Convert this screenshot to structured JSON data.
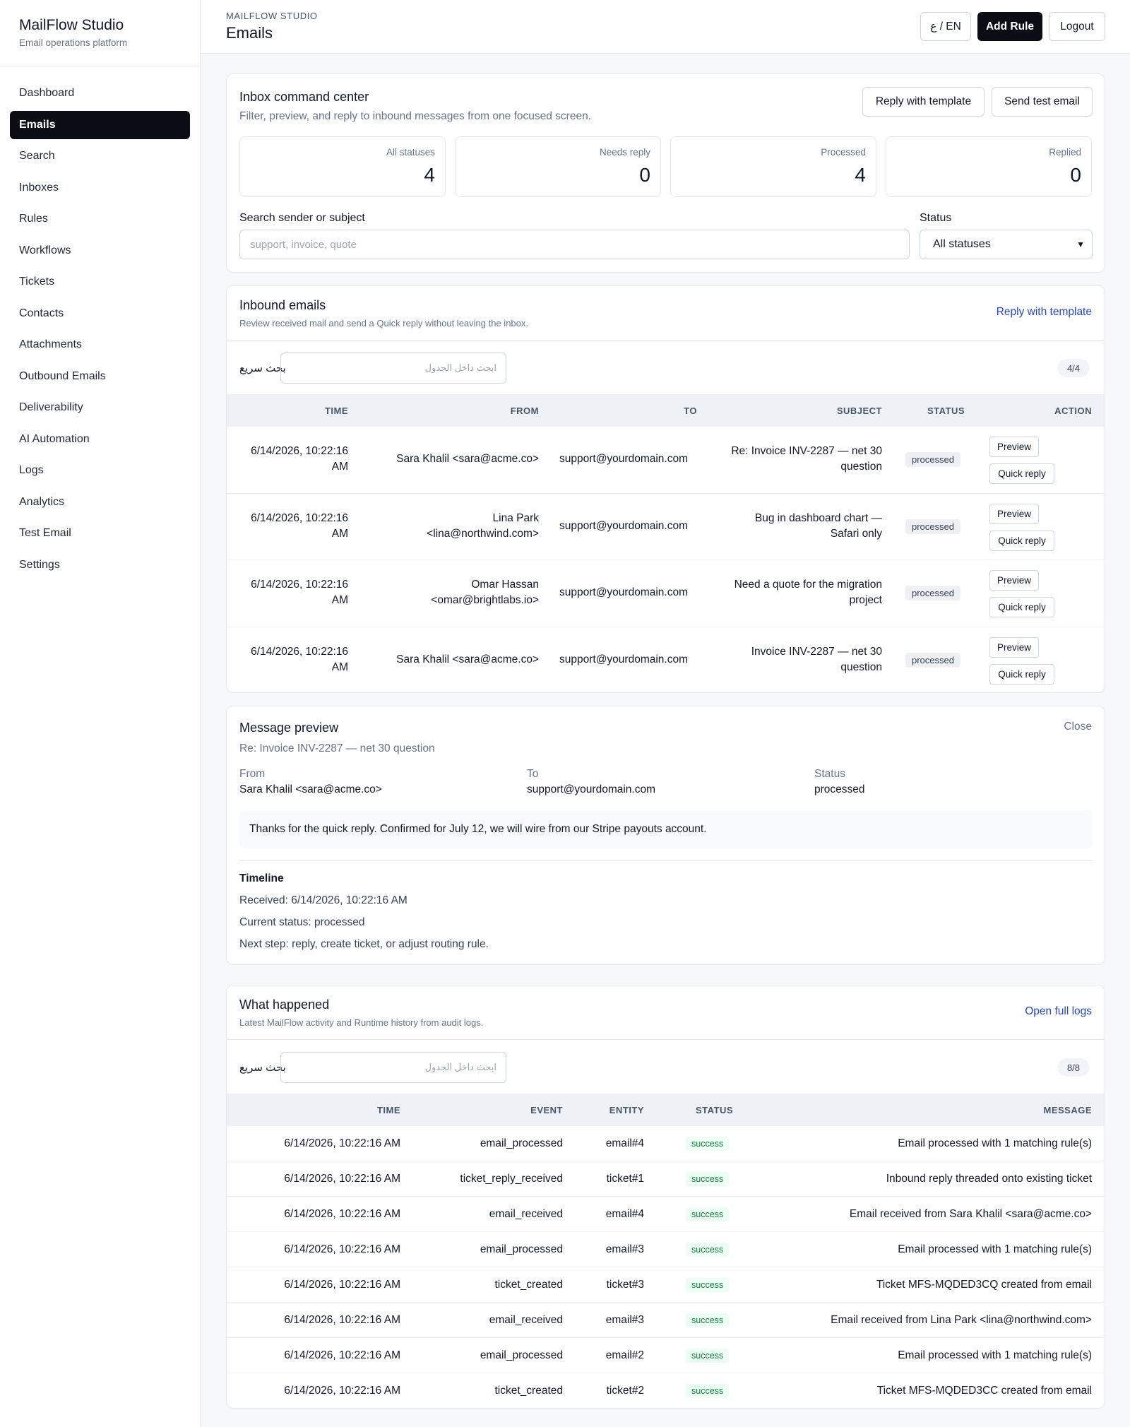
{
  "app": {
    "title": "MailFlow Studio",
    "subtitle": "Email operations platform"
  },
  "sidebar": {
    "items": [
      {
        "label": "Dashboard"
      },
      {
        "label": "Emails"
      },
      {
        "label": "Search"
      },
      {
        "label": "Inboxes"
      },
      {
        "label": "Rules"
      },
      {
        "label": "Workflows"
      },
      {
        "label": "Tickets"
      },
      {
        "label": "Contacts"
      },
      {
        "label": "Attachments"
      },
      {
        "label": "Outbound Emails"
      },
      {
        "label": "Deliverability"
      },
      {
        "label": "AI Automation"
      },
      {
        "label": "Logs"
      },
      {
        "label": "Analytics"
      },
      {
        "label": "Test Email"
      },
      {
        "label": "Settings"
      }
    ],
    "active": "Emails"
  },
  "header": {
    "kicker": "MAILFLOW STUDIO",
    "title": "Emails",
    "lang_toggle": "ع / EN",
    "add_rule": "Add Rule",
    "logout": "Logout"
  },
  "command_center": {
    "title": "Inbox command center",
    "subtitle": "Filter, preview, and reply to inbound messages from one focused screen.",
    "reply_template": "Reply with template",
    "send_test": "Send test email",
    "stats": [
      {
        "label": "All statuses",
        "value": "4"
      },
      {
        "label": "Needs reply",
        "value": "0"
      },
      {
        "label": "Processed",
        "value": "4"
      },
      {
        "label": "Replied",
        "value": "0"
      }
    ],
    "search_label": "Search sender or subject",
    "search_placeholder": "support, invoice, quote",
    "status_label": "Status",
    "status_value": "All statuses"
  },
  "inbound": {
    "title": "Inbound emails",
    "subtitle": "Review received mail and send a Quick reply without leaving the inbox.",
    "reply_template_link": "Reply with template",
    "quick_search_label": "بحث سريع",
    "quick_search_placeholder": "ابحث داخل الجدول",
    "count": "4/4",
    "columns": [
      "TIME",
      "FROM",
      "TO",
      "SUBJECT",
      "STATUS",
      "ACTION"
    ],
    "rows": [
      {
        "time1": "6/14/2026, 10:22:16",
        "time2": "AM",
        "from1": "Sara Khalil <sara@acme.co>",
        "from2": "",
        "to": "support@yourdomain.com",
        "subj1": "Re: Invoice INV-2287 — net 30",
        "subj2": "question",
        "status": "processed",
        "preview": "Preview",
        "quick": "Quick reply"
      },
      {
        "time1": "6/14/2026, 10:22:16",
        "time2": "AM",
        "from1": "Lina Park",
        "from2": "<lina@northwind.com>",
        "to": "support@yourdomain.com",
        "subj1": "Bug in dashboard chart —",
        "subj2": "Safari only",
        "status": "processed",
        "preview": "Preview",
        "quick": "Quick reply"
      },
      {
        "time1": "6/14/2026, 10:22:16",
        "time2": "AM",
        "from1": "Omar Hassan",
        "from2": "<omar@brightlabs.io>",
        "to": "support@yourdomain.com",
        "subj1": "Need a quote for the migration",
        "subj2": "project",
        "status": "processed",
        "preview": "Preview",
        "quick": "Quick reply"
      },
      {
        "time1": "6/14/2026, 10:22:16",
        "time2": "AM",
        "from1": "Sara Khalil <sara@acme.co>",
        "from2": "",
        "to": "support@yourdomain.com",
        "subj1": "Invoice INV-2287 — net 30",
        "subj2": "question",
        "status": "processed",
        "preview": "Preview",
        "quick": "Quick reply"
      }
    ]
  },
  "preview": {
    "title": "Message preview",
    "close": "Close",
    "subject": "Re: Invoice INV-2287 — net 30 question",
    "from_label": "From",
    "from_value": "Sara Khalil <sara@acme.co>",
    "to_label": "To",
    "to_value": "support@yourdomain.com",
    "status_label": "Status",
    "status_value": "processed",
    "body": "Thanks for the quick reply. Confirmed for July 12, we will wire from our Stripe payouts account.",
    "timeline_title": "Timeline",
    "timeline": [
      "Received: 6/14/2026, 10:22:16 AM",
      "Current status: processed",
      "Next step: reply, create ticket, or adjust routing rule."
    ]
  },
  "activity": {
    "title": "What happened",
    "subtitle": "Latest MailFlow activity and Runtime history from audit logs.",
    "open_logs": "Open full logs",
    "quick_search_label": "بحث سريع",
    "quick_search_placeholder": "ابحث داخل الجدول",
    "count": "8/8",
    "columns": [
      "TIME",
      "EVENT",
      "ENTITY",
      "STATUS",
      "MESSAGE"
    ],
    "rows": [
      {
        "time": "6/14/2026, 10:22:16 AM",
        "event": "email_processed",
        "entity": "email#4",
        "status": "success",
        "message": "Email processed with 1 matching rule(s)"
      },
      {
        "time": "6/14/2026, 10:22:16 AM",
        "event": "ticket_reply_received",
        "entity": "ticket#1",
        "status": "success",
        "message": "Inbound reply threaded onto existing ticket"
      },
      {
        "time": "6/14/2026, 10:22:16 AM",
        "event": "email_received",
        "entity": "email#4",
        "status": "success",
        "message": "Email received from Sara Khalil <sara@acme.co>"
      },
      {
        "time": "6/14/2026, 10:22:16 AM",
        "event": "email_processed",
        "entity": "email#3",
        "status": "success",
        "message": "Email processed with 1 matching rule(s)"
      },
      {
        "time": "6/14/2026, 10:22:16 AM",
        "event": "ticket_created",
        "entity": "ticket#3",
        "status": "success",
        "message": "Ticket MFS-MQDED3CQ created from email"
      },
      {
        "time": "6/14/2026, 10:22:16 AM",
        "event": "email_received",
        "entity": "email#3",
        "status": "success",
        "message": "Email received from Lina Park <lina@northwind.com>"
      },
      {
        "time": "6/14/2026, 10:22:16 AM",
        "event": "email_processed",
        "entity": "email#2",
        "status": "success",
        "message": "Email processed with 1 matching rule(s)"
      },
      {
        "time": "6/14/2026, 10:22:16 AM",
        "event": "ticket_created",
        "entity": "ticket#2",
        "status": "success",
        "message": "Ticket MFS-MQDED3CC created from email"
      }
    ]
  }
}
